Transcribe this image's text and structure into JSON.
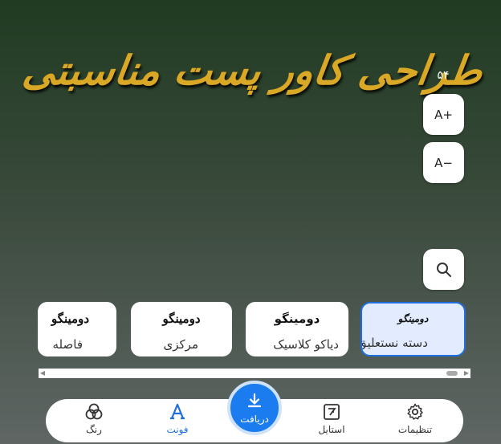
{
  "cover_text": "طراحی کاور پست مناسبتی",
  "colors": {
    "accent": "#1f6fe0",
    "fab": "#1b7cf0",
    "title_gold": "#d9a826"
  },
  "font_size": {
    "value": "۵۴",
    "increase_label": "A+",
    "decrease_label": "A−"
  },
  "search": {
    "icon": "search-icon"
  },
  "fonts": [
    {
      "sample": "دومینگو",
      "name": "فاصله",
      "selected": false
    },
    {
      "sample": "دومینگو",
      "name": "مرکزی",
      "selected": false
    },
    {
      "sample": "دومینگو",
      "name": "دیاکو کلاسیک",
      "selected": false
    },
    {
      "sample": "دومینگو",
      "name": "دسته نستعلیق",
      "selected": true
    }
  ],
  "nav": {
    "color": {
      "label": "رنگ",
      "icon": "palette-icon"
    },
    "font": {
      "label": "فونت",
      "icon": "font-icon"
    },
    "download": {
      "label": "دریافت",
      "icon": "download-icon"
    },
    "style": {
      "label": "استایل",
      "icon": "style-icon"
    },
    "settings": {
      "label": "تنظیمات",
      "icon": "gear-icon"
    }
  }
}
